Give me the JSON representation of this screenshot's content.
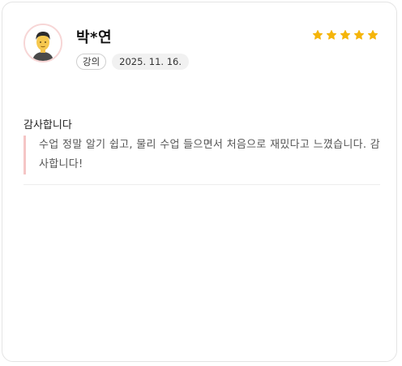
{
  "review": {
    "author": "박*연",
    "category_tag": "강의",
    "date": "2025. 11. 16.",
    "rating": 5,
    "title": "감사합니다",
    "body": "수업 정말 알기 쉽고, 물리 수업 들으면서 처음으로 재밌다고 느꼈습니다. 감사합니다!"
  },
  "icons": {
    "avatar": "man-avatar-icon",
    "star": "star-icon"
  },
  "colors": {
    "star": "#F5B50A",
    "quote_bar": "#F5C6C6",
    "avatar_border": "#F7D6D6"
  }
}
